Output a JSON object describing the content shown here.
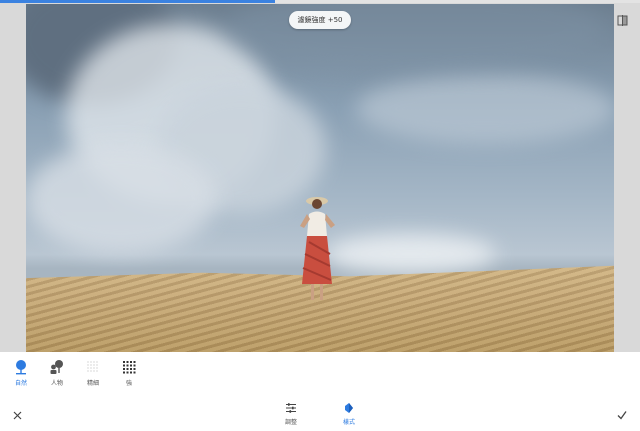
{
  "progress": {
    "fraction": 0.43
  },
  "image": {
    "description_icon": "photo-preview",
    "overlay": {
      "strength_label": "濾鏡強度 +50"
    }
  },
  "styles": {
    "items": [
      {
        "label": "自然",
        "icon": "natural-icon",
        "selected": true
      },
      {
        "label": "人物",
        "icon": "portrait-icon",
        "selected": false
      },
      {
        "label": "精細",
        "icon": "fine-icon",
        "selected": false
      },
      {
        "label": "強",
        "icon": "strong-icon",
        "selected": false
      }
    ]
  },
  "bottom_bar": {
    "cancel_icon": "close-icon",
    "apply_icon": "check-icon",
    "tabs": [
      {
        "label": "調整",
        "icon": "tune-icon",
        "active": false
      },
      {
        "label": "樣式",
        "icon": "style-icon",
        "active": true
      }
    ]
  },
  "colors": {
    "accent": "#2d7be0",
    "progress": "#3b82e0",
    "canvas_bg": "#d9d9d9"
  }
}
